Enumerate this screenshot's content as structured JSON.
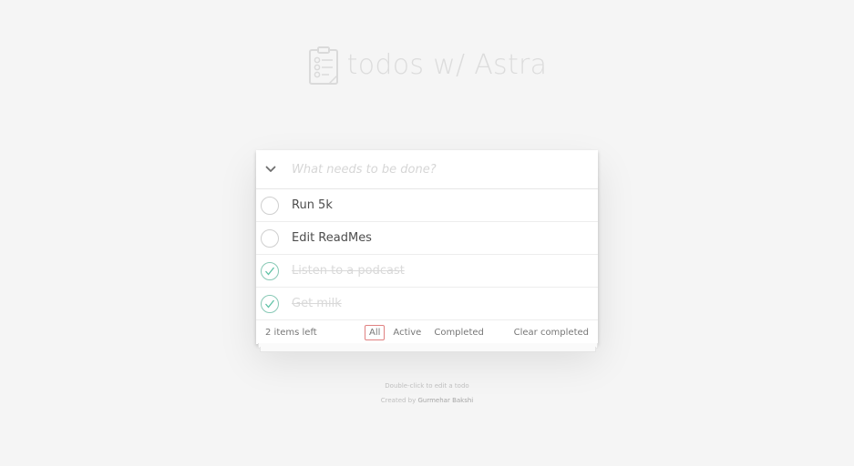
{
  "header": {
    "title": "todos w/ Astra",
    "logo_icon": "clipboard-checklist-icon"
  },
  "new_todo": {
    "placeholder": "What needs to be done?",
    "toggle_icon": "chevron-down-icon"
  },
  "todos": [
    {
      "label": "Run 5k",
      "completed": false
    },
    {
      "label": "Edit ReadMes",
      "completed": false
    },
    {
      "label": "Listen to a podcast",
      "completed": true
    },
    {
      "label": "Get milk",
      "completed": true
    }
  ],
  "footer": {
    "count_text": "2 items left",
    "filters": {
      "all": "All",
      "active": "Active",
      "completed": "Completed"
    },
    "selected_filter": "All",
    "clear_completed": "Clear completed"
  },
  "info": {
    "hint": "Double-click to edit a todo",
    "created_by_prefix": "Created by",
    "author": "Gurmehar Bakshi"
  },
  "colors": {
    "background": "#f5f5f5",
    "title": "#dcdcdc",
    "check_done": "#5dc2a5",
    "filter_selected_border": "#e08181"
  }
}
